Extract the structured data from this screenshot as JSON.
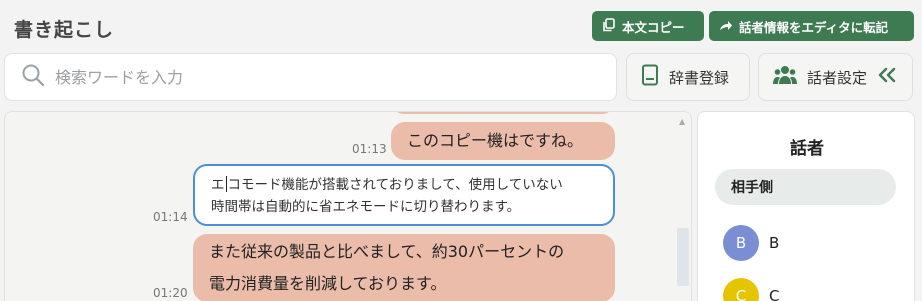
{
  "header": {
    "title": "書き起こし",
    "copy_button": "本文コピー",
    "transfer_button": "話者情報をエディタに転記"
  },
  "search": {
    "placeholder": "検索ワードを入力"
  },
  "toolbar": {
    "dictionary_button": "辞書登録",
    "speaker_settings_button": "話者設定"
  },
  "transcript": {
    "messages": [
      {
        "text": "このコピー機はですね。",
        "time": "01:13"
      },
      {
        "lines": [
          "エコモード機能が搭載されておりまして、使用していない",
          "時間帯は自動的に省エネモードに切り替わります。"
        ],
        "time": "01:14"
      },
      {
        "lines": [
          "また従来の製品と比べまして、約30パーセントの",
          "電力消費量を削減しております。"
        ],
        "time": "01:20"
      }
    ]
  },
  "speaker_panel": {
    "title": "話者",
    "group_label": "相手側",
    "speakers": [
      {
        "initial": "B",
        "name": "B",
        "color": "#7a8fd3"
      },
      {
        "initial": "C",
        "name": "C",
        "color": "#e6c400"
      }
    ]
  },
  "colors": {
    "accent_green": "#3e7a52",
    "bubble": "#ebbca9",
    "edit_border": "#4b8fd6"
  }
}
